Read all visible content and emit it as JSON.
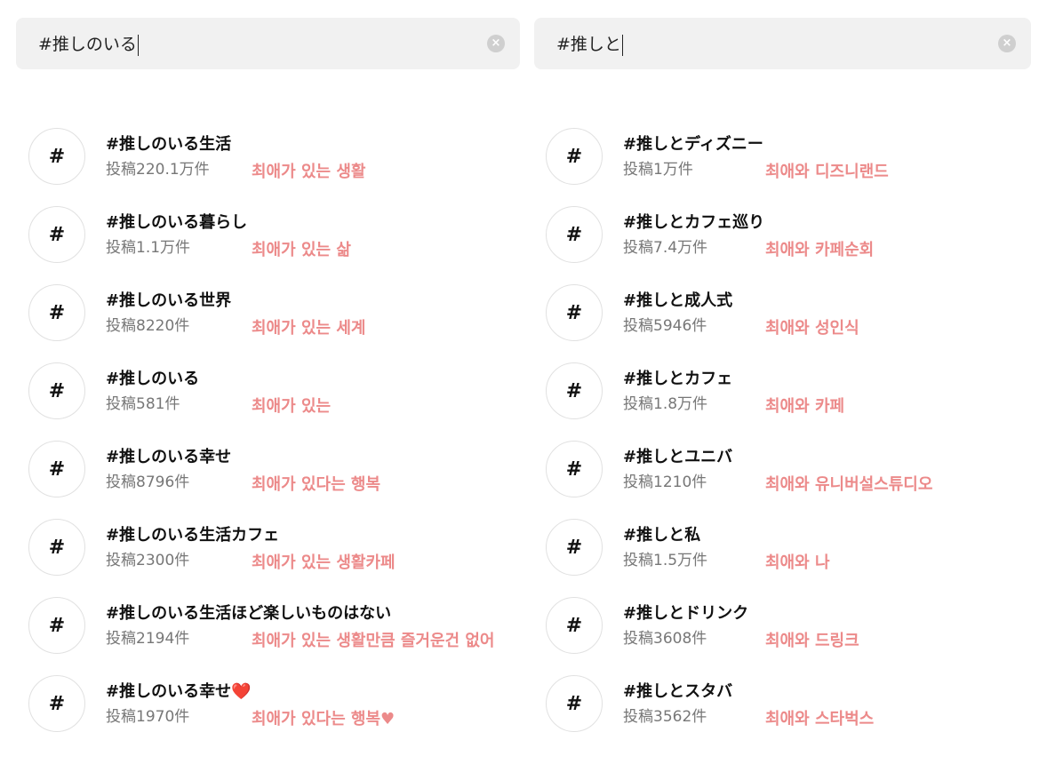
{
  "search_left": {
    "value": "#推しのいる",
    "clear_icon": "clear-circle-icon"
  },
  "search_right": {
    "value": "#推しと",
    "clear_icon": "clear-circle-icon"
  },
  "hash_symbol": "#",
  "left_results": [
    {
      "tag": "#推しのいる生活",
      "count": "投稿220.1万件",
      "note": "최애가 있는 생활"
    },
    {
      "tag": "#推しのいる暮らし",
      "count": "投稿1.1万件",
      "note": "최애가 있는 삶"
    },
    {
      "tag": "#推しのいる世界",
      "count": "投稿8220件",
      "note": "최애가 있는 세계"
    },
    {
      "tag": "#推しのいる",
      "count": "投稿581件",
      "note": "최애가 있는"
    },
    {
      "tag": "#推しのいる幸せ",
      "count": "投稿8796件",
      "note": "최애가 있다는 행복"
    },
    {
      "tag": "#推しのいる生活カフェ",
      "count": "投稿2300件",
      "note": "최애가 있는 생활카페"
    },
    {
      "tag": "#推しのいる生活ほど楽しいものはない",
      "count": "投稿2194件",
      "note": "최애가 있는 생활만큼 즐거운건 없어"
    },
    {
      "tag": "#推しのいる幸せ❤️",
      "count": "投稿1970件",
      "note": "최애가 있다는 행복♥"
    }
  ],
  "right_results": [
    {
      "tag": "#推しとディズニー",
      "count": "投稿1万件",
      "note": "최애와 디즈니랜드"
    },
    {
      "tag": "#推しとカフェ巡り",
      "count": "投稿7.4万件",
      "note": "최애와 카페순회"
    },
    {
      "tag": "#推しと成人式",
      "count": "投稿5946件",
      "note": "최애와 성인식"
    },
    {
      "tag": "#推しとカフェ",
      "count": "投稿1.8万件",
      "note": "최애와 카페"
    },
    {
      "tag": "#推しとユニバ",
      "count": "投稿1210件",
      "note": "최애와 유니버설스튜디오"
    },
    {
      "tag": "#推しと私",
      "count": "投稿1.5万件",
      "note": "최애와 나"
    },
    {
      "tag": "#推しとドリンク",
      "count": "投稿3608件",
      "note": "최애와 드링크"
    },
    {
      "tag": "#推しとスタバ",
      "count": "投稿3562件",
      "note": "최애와 스타벅스"
    }
  ]
}
